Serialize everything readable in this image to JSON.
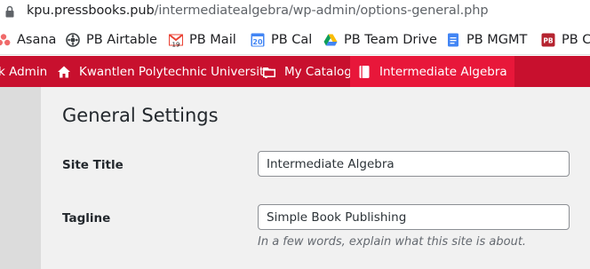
{
  "browser": {
    "url_host": "kpu.pressbooks.pub",
    "url_path": "/intermediatealgebra/wp-admin/options-general.php"
  },
  "bookmarks": [
    {
      "label": "Asana",
      "icon": "asana-icon"
    },
    {
      "label": "PB Airtable",
      "icon": "airtable-icon"
    },
    {
      "label": "PB Mail",
      "icon": "gmail-icon",
      "badge": "19"
    },
    {
      "label": "PB Cal",
      "icon": "calendar-icon",
      "badge": "20"
    },
    {
      "label": "PB Team Drive",
      "icon": "drive-icon"
    },
    {
      "label": "PB MGMT",
      "icon": "docs-icon"
    },
    {
      "label": "PB C",
      "icon": "pressbooks-icon",
      "badge": "PB"
    }
  ],
  "adminbar": {
    "items": [
      {
        "label": "k Admin"
      },
      {
        "label": "Kwantlen Polytechnic University",
        "icon": "home-icon"
      },
      {
        "label": "My Catalog",
        "icon": "folder-icon"
      },
      {
        "label": "Intermediate Algebra",
        "icon": "book-icon"
      }
    ],
    "color": "#c8102e"
  },
  "page": {
    "title": "General Settings",
    "site_title": {
      "label": "Site Title",
      "value": "Intermediate Algebra"
    },
    "tagline": {
      "label": "Tagline",
      "value": "Simple Book Publishing",
      "hint": "In a few words, explain what this site is about."
    }
  }
}
